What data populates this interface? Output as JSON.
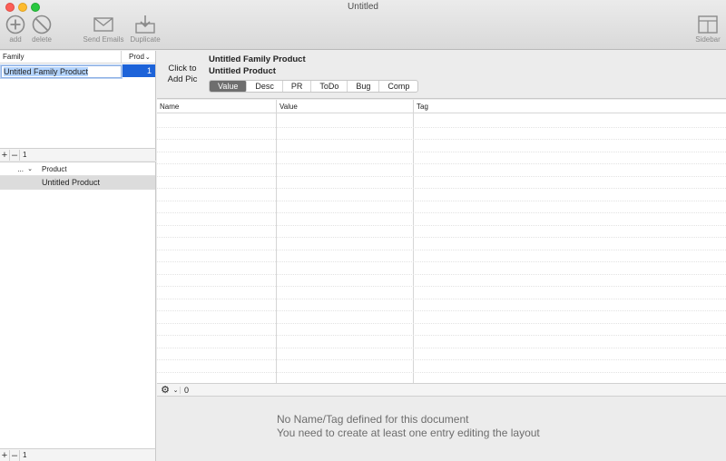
{
  "window": {
    "title": "Untitled"
  },
  "toolbar": {
    "add_label": "add",
    "delete_label": "delete",
    "send_emails_label": "Send Emails",
    "duplicate_label": "Duplicate",
    "sidebar_label": "Sidebar"
  },
  "family_table": {
    "columns": [
      "Family",
      "Prod"
    ],
    "rows": [
      {
        "family": "Untitled Family Product",
        "prod": "1"
      }
    ],
    "count": "1",
    "add_glyph": "+",
    "remove_glyph": "–"
  },
  "product_table": {
    "dots": "...",
    "chevron": "⌄",
    "column": "Product",
    "rows": [
      "Untitled Product"
    ],
    "count": "1",
    "add_glyph": "+",
    "remove_glyph": "–"
  },
  "detail": {
    "add_pic_line1": "Click to",
    "add_pic_line2": "Add Pic",
    "family_title": "Untitled Family Product",
    "product_title": "Untitled Product",
    "tabs": [
      "Value",
      "Desc",
      "PR",
      "ToDo",
      "Bug",
      "Comp"
    ],
    "active_tab": "Value"
  },
  "value_table": {
    "columns": [
      "Name",
      "Value",
      "Tag"
    ]
  },
  "gear_bar": {
    "gear_glyph": "⚙",
    "chevron": "⌄",
    "count": "0"
  },
  "message": {
    "line1": "No Name/Tag defined for this document",
    "line2": "You need to create at least one entry editing the layout"
  },
  "colors": {
    "selection": "#1d63d9",
    "active_tab": "#6e6e6e"
  },
  "icons": [
    "add-circle-icon",
    "delete-circle-icon",
    "envelope-icon",
    "duplicate-icon",
    "sidebar-icon",
    "gear-icon"
  ]
}
